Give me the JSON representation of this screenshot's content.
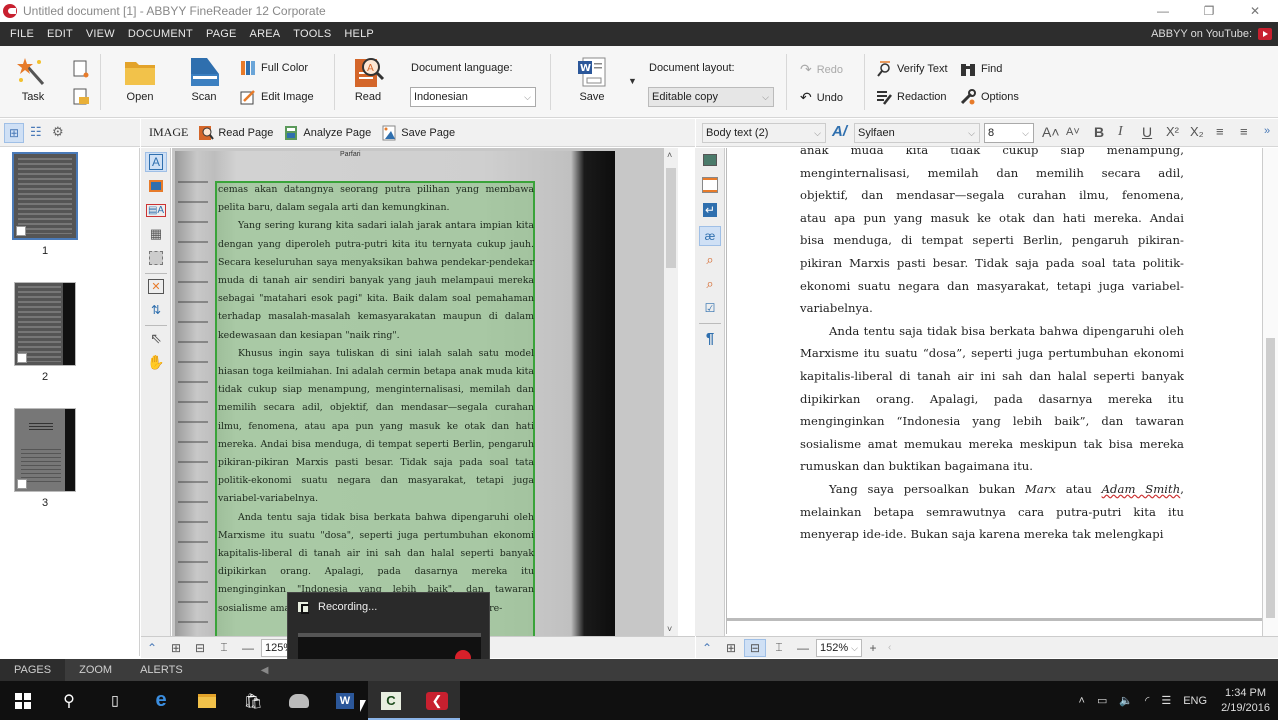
{
  "window": {
    "title": "Untitled document [1] - ABBYY FineReader 12 Corporate",
    "controls": {
      "minimize": "—",
      "restore": "❐",
      "close": "✕"
    }
  },
  "menu": {
    "items": [
      "FILE",
      "EDIT",
      "VIEW",
      "DOCUMENT",
      "PAGE",
      "AREA",
      "TOOLS",
      "HELP"
    ],
    "youtube_label": "ABBYY on YouTube:"
  },
  "ribbon": {
    "task": "Task",
    "open": "Open",
    "scan": "Scan",
    "full_color": "Full Color",
    "edit_image": "Edit Image",
    "read": "Read",
    "doc_language_label": "Document language:",
    "doc_language_value": "Indonesian",
    "save": "Save",
    "doc_layout_label": "Document layout:",
    "doc_layout_value": "Editable copy",
    "redo": "Redo",
    "undo": "Undo",
    "verify_text": "Verify Text",
    "find": "Find",
    "redaction": "Redaction",
    "options": "Options"
  },
  "image_toolbar": {
    "label": "IMAGE",
    "read_page": "Read Page",
    "analyze_page": "Analyze Page",
    "save_page": "Save Page"
  },
  "text_toolbar": {
    "style": "Body text (2)",
    "font": "Sylfaen",
    "size": "8"
  },
  "pages": {
    "thumbnails": [
      {
        "number": "1",
        "selected": true
      },
      {
        "number": "2",
        "selected": false
      },
      {
        "number": "3",
        "selected": false
      }
    ]
  },
  "image_pane": {
    "running_head": "Parfari",
    "paragraphs": [
      "cemas akan datangnya seorang putra pilihan yang membawa pelita baru, dalam segala arti dan kemungkinan.",
      "Yang sering kurang kita sadari ialah jarak antara impian kita dengan yang diperoleh putra-putri kita itu ternyata cukup jauh. Secara keseluruhan saya menyaksikan bahwa pendekar-pendekar muda di tanah air sendiri banyak yang jauh melampaui mereka sebagai \"matahari esok pagi\" kita. Baik dalam soal pemahaman terhadap masalah-masalah kemasyarakatan maupun di dalam kedewasaan dan kesiapan \"naik ring\".",
      "Khusus ingin saya tuliskan di sini ialah salah satu model hiasan toga keilmiahan. Ini adalah cermin betapa anak muda kita tidak cukup siap menampung, menginternalisasi, memilah dan memilih secara adil, objektif, dan mendasar—segala curahan ilmu, fenomena, atau apa pun yang masuk ke otak dan hati mereka. Andai bisa menduga, di tempat seperti Berlin, pengaruh pikiran-pikiran Marxis pasti besar. Tidak saja pada soal tata politik-ekonomi suatu negara dan masyarakat, tetapi juga variabel-variabelnya.",
      "Anda tentu saja tidak bisa berkata bahwa dipengaruhi oleh Marxisme itu suatu \"dosa\", seperti juga pertumbuhan ekonomi kapitalis-liberal di tanah air ini sah dan halal seperti banyak dipikirkan orang. Apalagi, pada dasarnya mereka itu menginginkan \"Indonesia yang lebih baik\", dan tawaran sosialisme amat memukau mereka meskipun tak bisa mere-"
    ],
    "zoom": "125%"
  },
  "text_pane": {
    "paragraph1_lines": [
      "anak muda kita tidak cukup siap menampung,",
      "menginternalisasi, memilah dan memilih secara adil,",
      "objektif, dan mendasar—segala curahan ilmu, fenomena,",
      "atau apa pun yang masuk ke otak dan hati mereka. Andai",
      "bisa menduga, di tempat seperti Berlin, pengaruh pikiran-",
      "pikiran Marxis pasti besar. Tidak saja pada soal tata politik-",
      "ekonomi suatu negara dan masyarakat, tetapi juga variabel-",
      "variabelnya."
    ],
    "paragraph2": "Anda tentu saja tidak bisa berkata bahwa dipengaruhi oleh Marxisme itu suatu “dosa”, seperti juga pertumbuhan ekonomi kapitalis-liberal di tanah air ini sah dan halal seperti banyak dipikirkan orang. Apalagi, pada dasarnya mereka itu menginginkan “Indonesia yang lebih baik”, dan tawaran sosialisme amat memukau mereka meskipun tak bisa mereka rumuskan dan buktikan bagaimana itu.",
    "paragraph3": {
      "before": "Yang saya persoalkan bukan ",
      "italic1": "Marx",
      "middle": " atau ",
      "italic2": "Adam Smith",
      "after": ", melainkan betapa semrawutnya cara putra-putri kita itu menyerap ide-ide. Bukan saja karena mereka tak melengkapi"
    },
    "zoom": "152%"
  },
  "status_tabs": [
    "PAGES",
    "ZOOM",
    "ALERTS"
  ],
  "recording_popup": {
    "title": "Recording..."
  },
  "taskbar": {
    "language": "ENG",
    "time": "1:34 PM",
    "date": "2/19/2016"
  },
  "colors": {
    "accent": "#c8202f",
    "menubar": "#2d2d2d",
    "selection": "#cfe0f5",
    "recognized_area": "#3aa33a",
    "uncertain_highlight": "#8fe8ee"
  }
}
